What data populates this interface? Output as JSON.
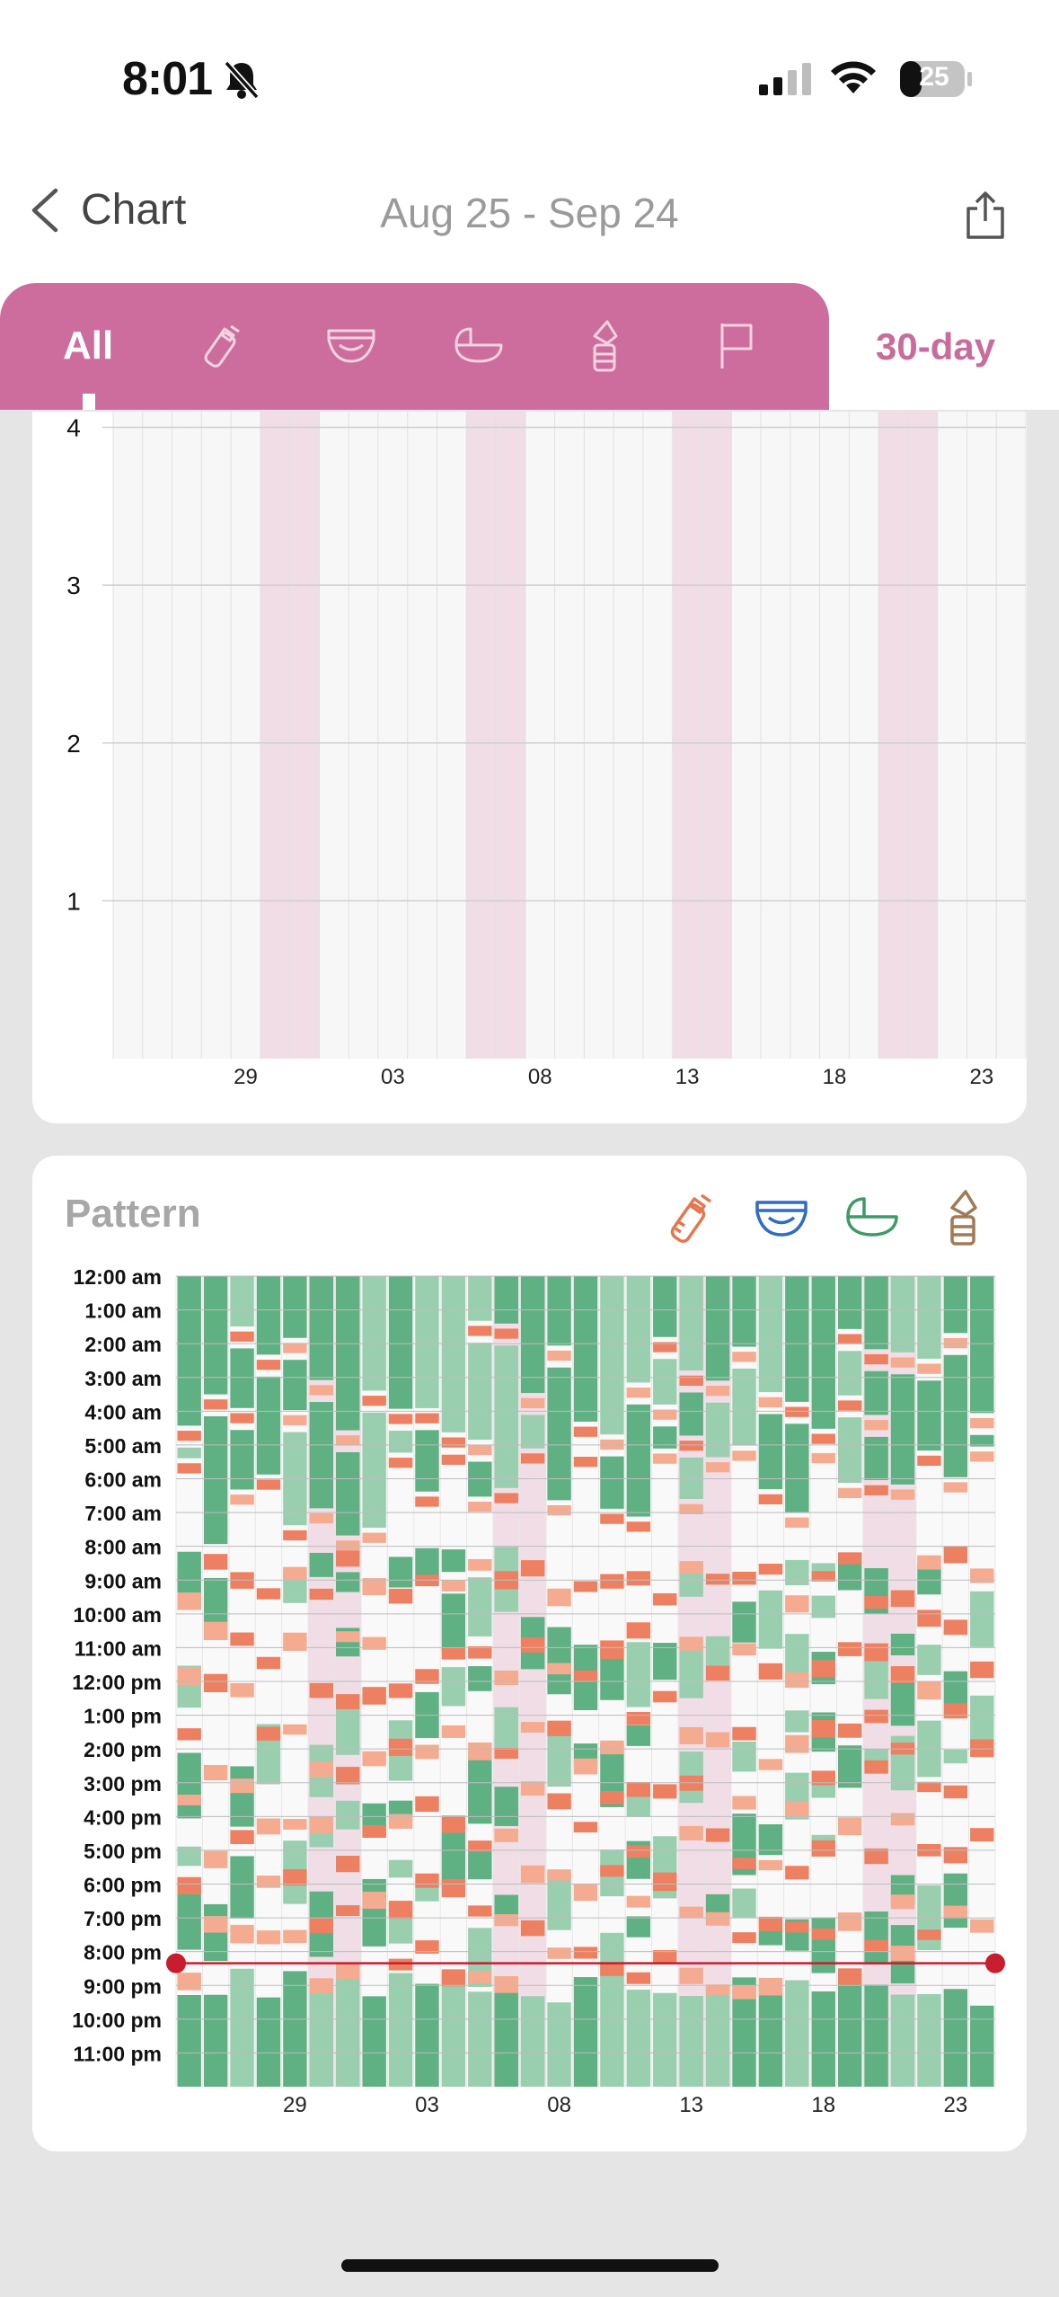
{
  "status_bar": {
    "time": "8:01",
    "battery_level": "25",
    "icons": [
      "bell-slash-icon",
      "cellular-signal-icon",
      "wifi-icon",
      "battery-icon"
    ]
  },
  "nav": {
    "back_label": "Chart",
    "date_range": "Aug 25 - Sep 24",
    "icons": [
      "chevron-left-icon",
      "share-icon"
    ]
  },
  "tabs": {
    "all_label": "All",
    "icons": [
      "bottle-icon",
      "diaper-icon",
      "bassinet-icon",
      "breast-pump-icon",
      "flag-icon"
    ],
    "period_label": "30-day"
  },
  "colors": {
    "accent": "#cc6d9e",
    "sleep_dark": "#5fb083",
    "sleep_light": "#99cfae",
    "feed_orange": "#ee8062",
    "feed_light": "#f4ab90",
    "weekend_band": "#f0dde6"
  },
  "chart_data": [
    {
      "type": "bar",
      "y_ticks": [
        "1",
        "2",
        "3",
        "4"
      ],
      "ylim": [
        0,
        4.1
      ],
      "x_tick_labels": [
        "29",
        "03",
        "08",
        "13",
        "18",
        "23"
      ],
      "categories": [
        "Aug 25",
        "Aug 26",
        "Aug 27",
        "Aug 28",
        "Aug 29",
        "Aug 30",
        "Aug 31",
        "Sep 01",
        "Sep 02",
        "Sep 03",
        "Sep 04",
        "Sep 05",
        "Sep 06",
        "Sep 07",
        "Sep 08",
        "Sep 09",
        "Sep 10",
        "Sep 11",
        "Sep 12",
        "Sep 13",
        "Sep 14",
        "Sep 15",
        "Sep 16",
        "Sep 17",
        "Sep 18",
        "Sep 19",
        "Sep 20",
        "Sep 21",
        "Sep 22",
        "Sep 23",
        "Sep 24"
      ],
      "values": [
        0,
        0,
        0,
        0,
        0,
        0,
        0,
        0,
        0,
        0,
        0,
        0,
        0,
        0,
        0,
        0,
        0,
        0,
        0,
        0,
        0,
        0,
        0,
        0,
        0,
        0,
        0,
        0,
        0,
        0,
        0
      ],
      "weekend_days": [
        "Aug 30",
        "Aug 31",
        "Sep 06",
        "Sep 07",
        "Sep 13",
        "Sep 14",
        "Sep 20",
        "Sep 21"
      ],
      "grid": true
    },
    {
      "type": "heatmap",
      "title": "Pattern",
      "legend_icons": [
        "bottle-icon",
        "diaper-icon",
        "bassinet-icon",
        "breast-pump-icon"
      ],
      "y_labels": [
        "12:00 am",
        "1:00 am",
        "2:00 am",
        "3:00 am",
        "4:00 am",
        "5:00 am",
        "6:00 am",
        "7:00 am",
        "8:00 am",
        "9:00 am",
        "10:00 am",
        "11:00 am",
        "12:00 pm",
        "1:00 pm",
        "2:00 pm",
        "3:00 pm",
        "4:00 pm",
        "5:00 pm",
        "6:00 pm",
        "7:00 pm",
        "8:00 pm",
        "9:00 pm",
        "10:00 pm",
        "11:00 pm"
      ],
      "x_tick_labels": [
        "29",
        "03",
        "08",
        "13",
        "18",
        "23"
      ],
      "days": 31,
      "weekend_day_index": [
        5,
        6,
        12,
        13,
        19,
        20,
        26,
        27
      ],
      "current_time_marker_hour": 20.0,
      "grid": true
    }
  ]
}
